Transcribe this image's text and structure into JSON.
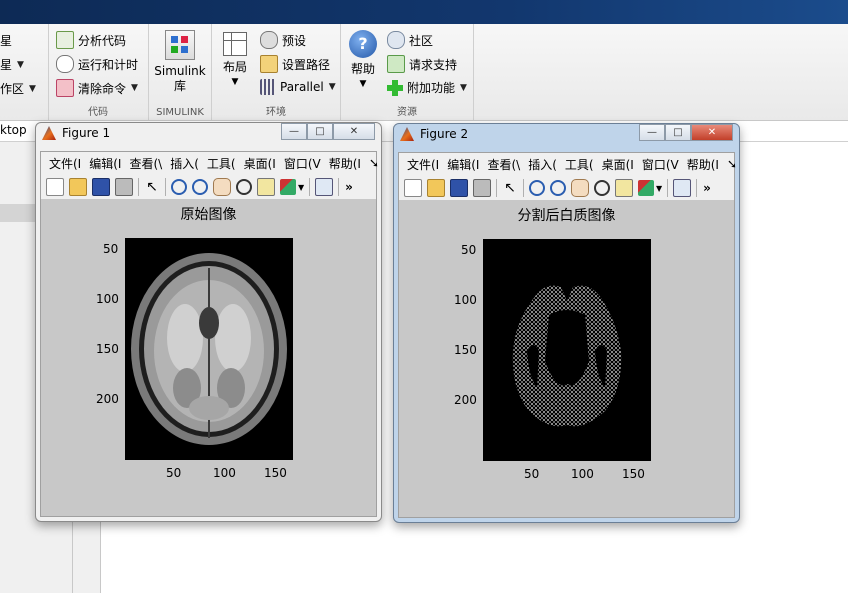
{
  "ribbon": {
    "left_items": [
      "星",
      "星",
      "作区"
    ],
    "code_group": {
      "items": [
        "分析代码",
        "运行和计时",
        "清除命令"
      ],
      "label": "代码"
    },
    "simulink_group": {
      "button_line1": "Simulink",
      "button_line2": "库",
      "label": "SIMULINK"
    },
    "env_group": {
      "layout_label": "布局",
      "items": [
        "预设",
        "设置路径",
        "Parallel"
      ],
      "label": "环境"
    },
    "resources_group": {
      "help_label": "帮助",
      "items": [
        "社区",
        "请求支持",
        "附加功能"
      ],
      "label": "资源"
    }
  },
  "address_bar": {
    "text": "ktop"
  },
  "figure1": {
    "title": "Figure 1",
    "menus": [
      "文件(I",
      "编辑(I",
      "查看(\\",
      "插入(",
      "工具(",
      "桌面(I",
      "窗口(V",
      "帮助(I"
    ],
    "axes_title": "原始图像",
    "yticks": [
      "50",
      "100",
      "150",
      "200"
    ],
    "xticks": [
      "50",
      "100",
      "150"
    ]
  },
  "figure2": {
    "title": "Figure 2",
    "menus": [
      "文件(I",
      "编辑(I",
      "查看(\\",
      "插入(",
      "工具(",
      "桌面(I",
      "窗口(V",
      "帮助(I"
    ],
    "axes_title": "分割后白质图像",
    "yticks": [
      "50",
      "100",
      "150",
      "200"
    ],
    "xticks": [
      "50",
      "100",
      "150"
    ]
  },
  "icons": {
    "toolbar": [
      "new-file-icon",
      "open-folder-icon",
      "save-icon",
      "print-icon",
      "pointer-icon",
      "zoom-in-icon",
      "zoom-out-icon",
      "pan-hand-icon",
      "rotate-3d-icon",
      "data-cursor-icon",
      "brush-icon",
      "link-plot-icon",
      "more-icon"
    ]
  },
  "colors": {
    "window_title_bar": "#0d2a55",
    "active_frame": "#bfd4ea",
    "figure_canvas": "#c8c8c8"
  }
}
